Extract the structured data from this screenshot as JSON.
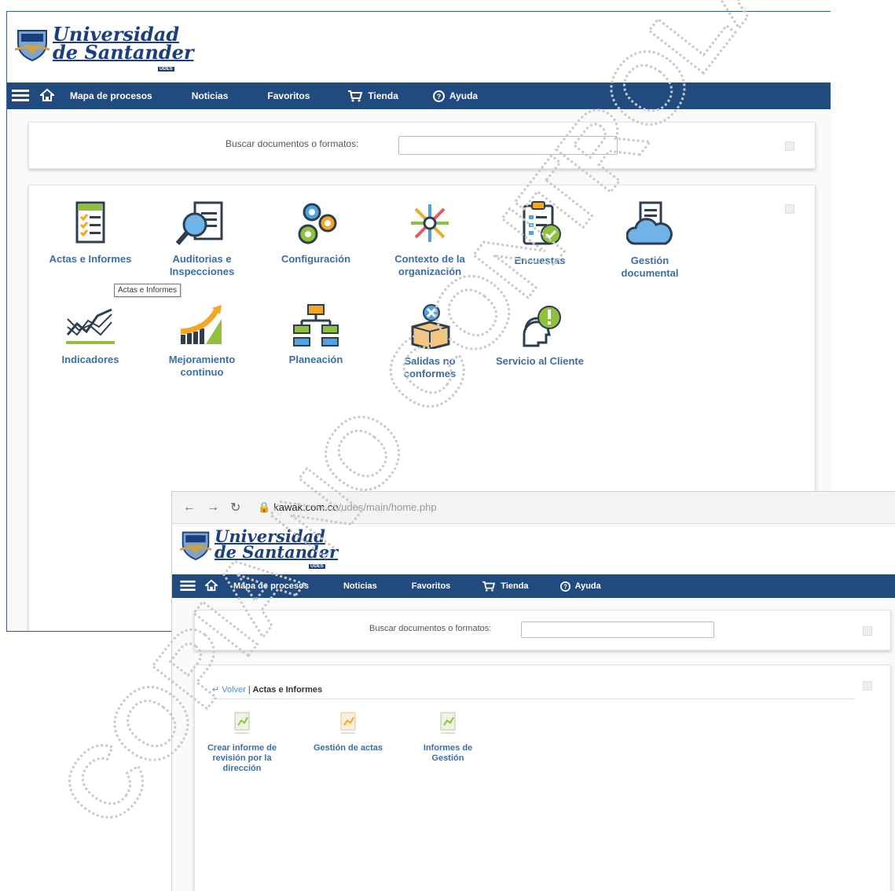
{
  "university": {
    "line1": "Universidad",
    "line2": "de Santander",
    "sub": "UDES"
  },
  "nav": {
    "mapa": "Mapa de procesos",
    "noticias": "Noticias",
    "favoritos": "Favoritos",
    "tienda": "Tienda",
    "ayuda": "Ayuda"
  },
  "search": {
    "label": "Buscar documentos o formatos:",
    "value": ""
  },
  "modules": [
    {
      "label": "Actas e Informes",
      "icon": "document-checklist-icon"
    },
    {
      "label": "Auditorias e Inspecciones",
      "icon": "magnifier-document-icon"
    },
    {
      "label": "Configuración",
      "icon": "gears-icon"
    },
    {
      "label": "Contexto de la organización",
      "icon": "arrows-hub-icon"
    },
    {
      "label": "Encuestas",
      "icon": "survey-clipboard-icon"
    },
    {
      "label": "Gestión documental",
      "icon": "cloud-document-icon"
    },
    {
      "label": "Indicadores",
      "icon": "line-chart-icon"
    },
    {
      "label": "Mejoramiento continuo",
      "icon": "growth-bars-icon"
    },
    {
      "label": "Planeación",
      "icon": "flowchart-icon"
    },
    {
      "label": "Salidas no conformes",
      "icon": "box-reject-icon"
    },
    {
      "label": "Servicio al Cliente",
      "icon": "customer-support-icon"
    }
  ],
  "tooltip": "Actas e Informes",
  "browser": {
    "url_host": "kawak.com.co",
    "url_path": "/udes/main/home.php"
  },
  "breadcrumb": {
    "back": "Volver",
    "separator": "|",
    "current": "Actas e Informes"
  },
  "submodules": [
    {
      "label": "Crear informe de revisión por la dirección"
    },
    {
      "label": "Gestión de actas"
    },
    {
      "label": "Informes de Gestión"
    }
  ],
  "watermark": "COPIA NO CONTROLADA",
  "colors": {
    "navbar": "#214a7e",
    "brand": "#1a3f80",
    "link": "#3b6ea5"
  }
}
